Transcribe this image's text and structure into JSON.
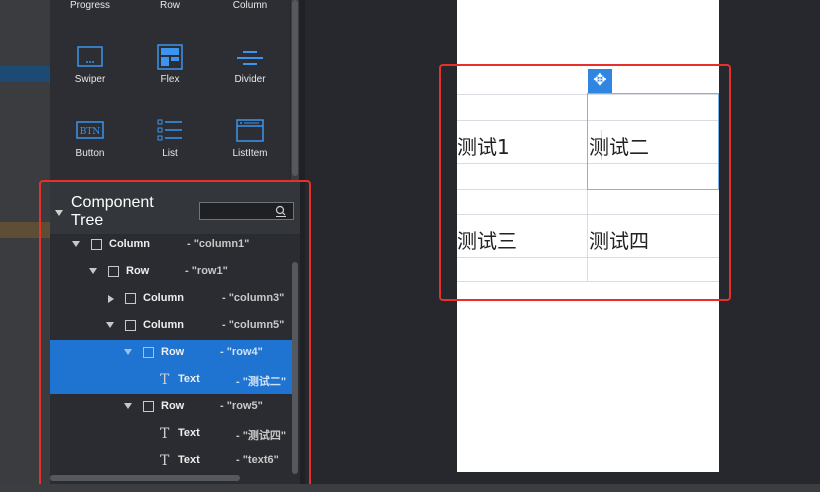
{
  "palette": {
    "items": [
      {
        "label": "Progress",
        "icon": "progress-icon"
      },
      {
        "label": "Row",
        "icon": "row-icon"
      },
      {
        "label": "Column",
        "icon": "column-icon"
      },
      {
        "label": "Swiper",
        "icon": "swiper-icon"
      },
      {
        "label": "Flex",
        "icon": "flex-icon"
      },
      {
        "label": "Divider",
        "icon": "divider-icon"
      },
      {
        "label": "Button",
        "icon": "button-icon"
      },
      {
        "label": "List",
        "icon": "list-icon"
      },
      {
        "label": "ListItem",
        "icon": "listitem-icon"
      }
    ],
    "button_icon_text": "BTN"
  },
  "tree": {
    "title": "Component Tree",
    "search_value": "",
    "nodes": [
      {
        "name": "Column",
        "value": "- \"column1\""
      },
      {
        "name": "Row",
        "value": "- \"row1\""
      },
      {
        "name": "Column",
        "value": "- \"column3\""
      },
      {
        "name": "Column",
        "value": "- \"column5\""
      },
      {
        "name": "Row",
        "value": "- \"row4\""
      },
      {
        "name": "Text",
        "value": "- \"测试二\""
      },
      {
        "name": "Row",
        "value": "- \"row5\""
      },
      {
        "name": "Text",
        "value": "- \"测试四\""
      },
      {
        "name": "Text",
        "value": "- \"text6\""
      }
    ]
  },
  "canvas": {
    "cells": [
      "测试1",
      "测试二",
      "测试三",
      "测试四"
    ]
  },
  "colors": {
    "selection": "#1e74d0",
    "highlight_box": "#e8302a",
    "move_handle": "#2f86e0"
  }
}
